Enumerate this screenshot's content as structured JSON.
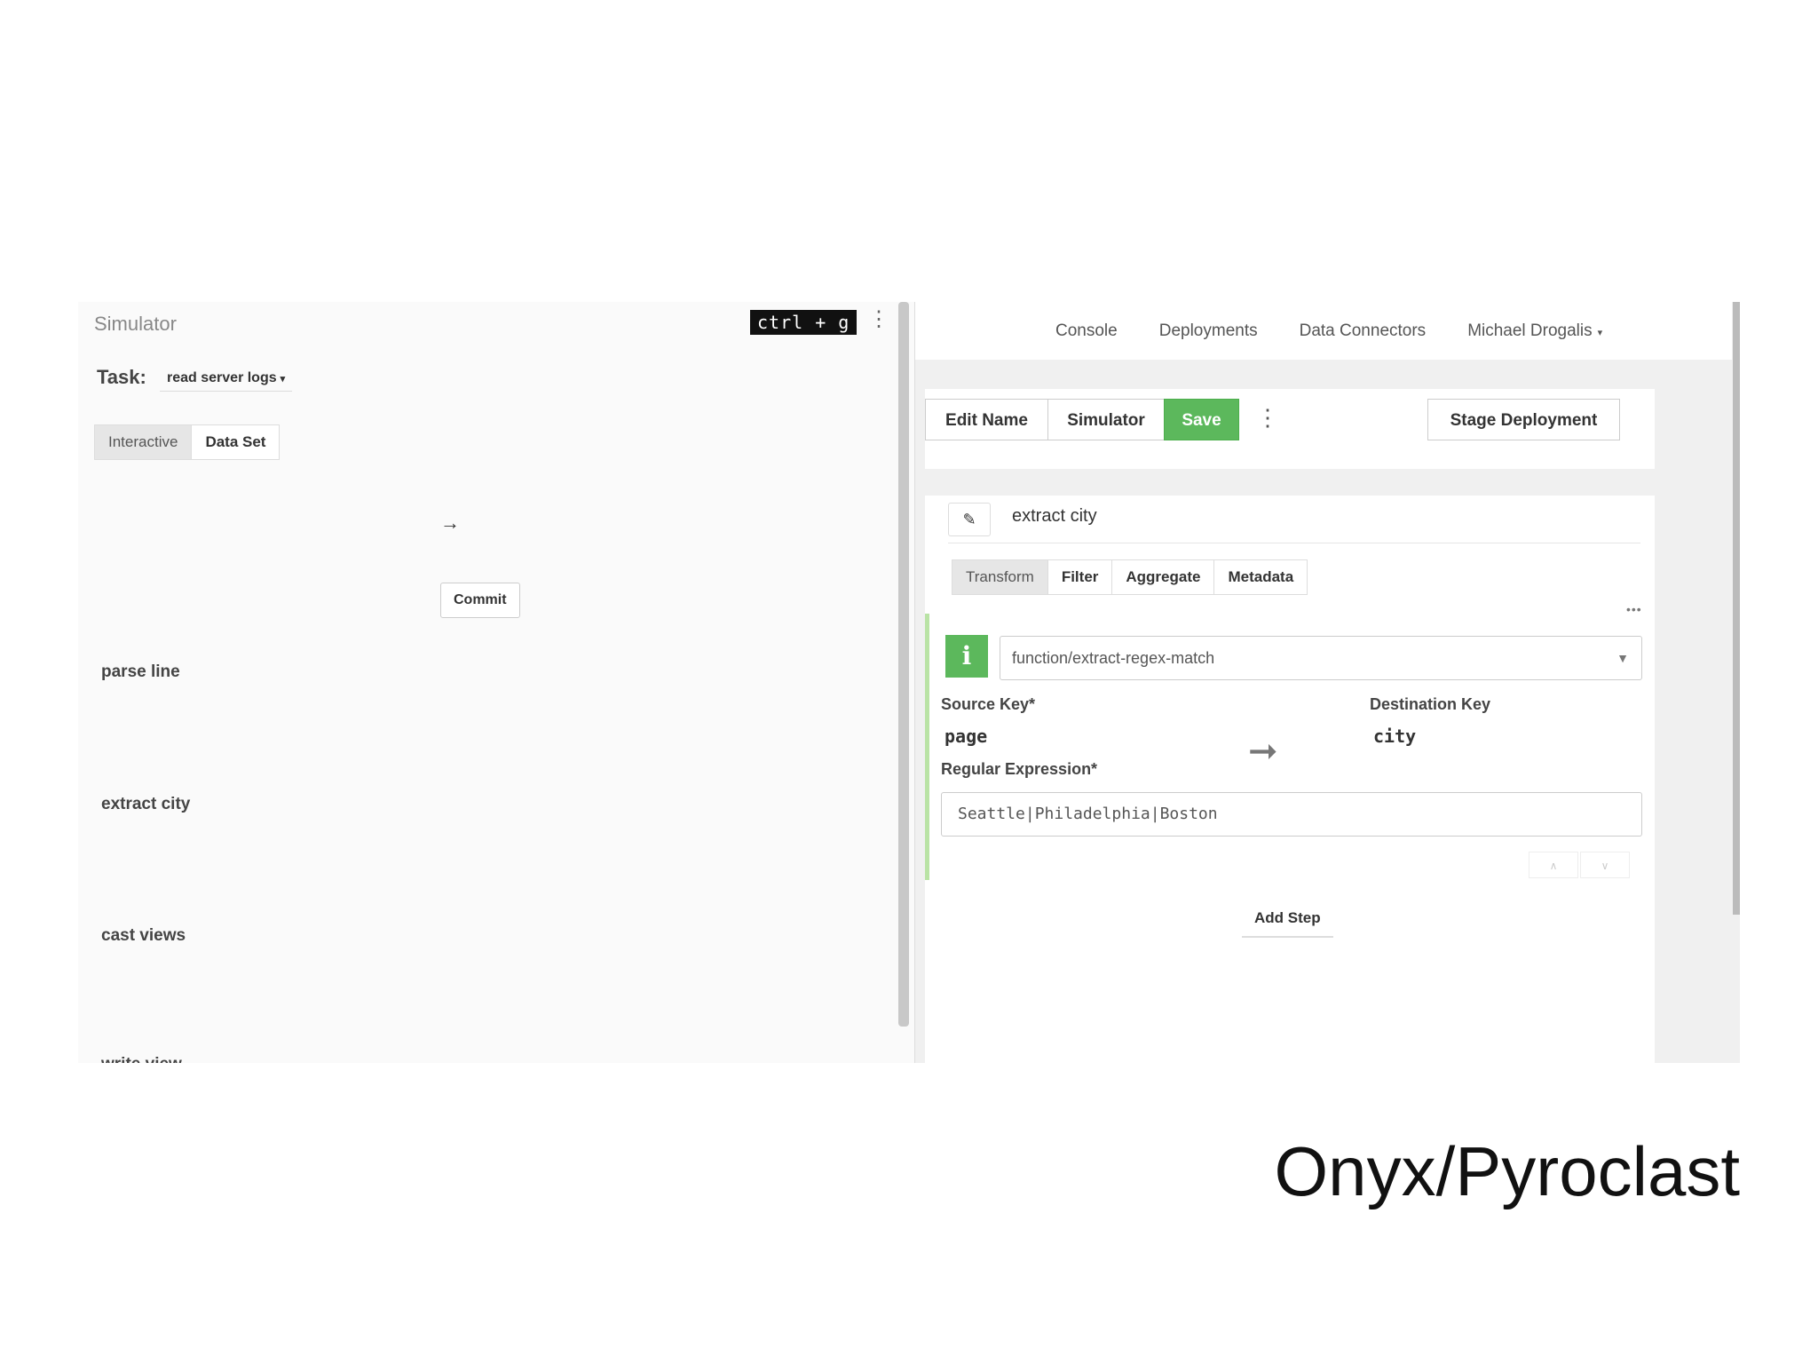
{
  "simulator": {
    "title": "Simulator",
    "shortcut": "ctrl + g",
    "menu_glyph": "⋮",
    "task_label": "Task:",
    "task_value": "read server logs",
    "mode_tabs": [
      {
        "label": "Interactive",
        "active": true
      },
      {
        "label": "Data Set",
        "active": false
      }
    ],
    "arrow_glyph": "→",
    "commit_label": "Commit",
    "task_list": [
      "parse line",
      "extract city",
      "cast views",
      "write view"
    ]
  },
  "nav": {
    "links": [
      "Console",
      "Deployments",
      "Data Connectors"
    ],
    "user": "Michael Drogalis"
  },
  "toolbar": {
    "edit_name_label": "Edit Name",
    "simulator_label": "Simulator",
    "save_label": "Save",
    "menu_glyph": "⋮",
    "stage_label": "Stage Deployment"
  },
  "step": {
    "edit_glyph": "✎",
    "name": "extract city",
    "tabs": [
      {
        "label": "Transform",
        "active": true
      },
      {
        "label": "Filter",
        "active": false
      },
      {
        "label": "Aggregate",
        "active": false
      },
      {
        "label": "Metadata",
        "active": false
      }
    ],
    "more_glyph": "•••",
    "info_glyph": "i",
    "function": "function/extract-regex-match",
    "source_key_label": "Source Key*",
    "source_key_value": "page",
    "flow_glyph": "➞",
    "destination_key_label": "Destination Key",
    "destination_key_value": "city",
    "regex_label": "Regular Expression*",
    "regex_value": "Seattle|Philadelphia|Boston",
    "move_up_glyph": "∧",
    "move_down_glyph": "∨",
    "add_step_label": "Add Step"
  },
  "caption": "Onyx/Pyroclast",
  "colors": {
    "save_green": "#5cb85c",
    "active_edge": "#b9e3a5"
  },
  "icons": {
    "edit": "pencil-icon",
    "info": "info-icon",
    "dropdown": "chevron-down-icon",
    "kebab": "kebab-menu-icon"
  }
}
